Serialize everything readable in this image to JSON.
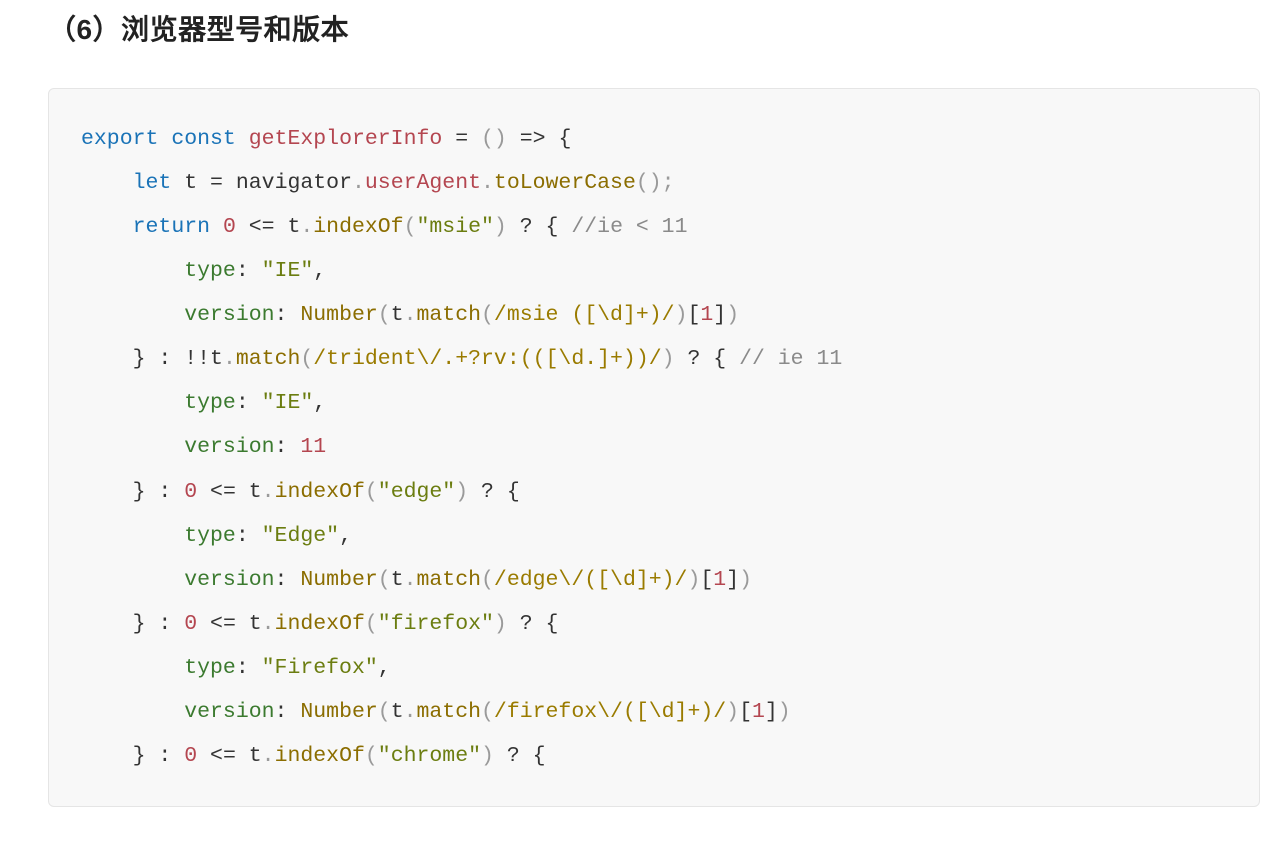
{
  "heading": "（6）浏览器型号和版本",
  "code": {
    "l1": {
      "export": "export",
      "const": "const",
      "fn": "getExplorerInfo",
      "eq": " = ",
      "paren": "()",
      "arrow": " => ",
      "brace": "{"
    },
    "l2": {
      "let": "let",
      "t": "t",
      "eq": " = ",
      "nav": "navigator",
      "dot1": ".",
      "ua": "userAgent",
      "dot2": ".",
      "tlc": "toLowerCase",
      "call": "();"
    },
    "l3": {
      "return": "return",
      "zero": "0",
      "lte": " <= ",
      "t": "t",
      "dot": ".",
      "idx": "indexOf",
      "op": "(",
      "str": "\"msie\"",
      "cp": ")",
      "q": " ? ",
      "br": "{ ",
      "cm": "//ie < 11"
    },
    "l4": {
      "key": "type",
      "colon": ": ",
      "val": "\"IE\"",
      "comma": ","
    },
    "l5": {
      "key": "version",
      "colon": ": ",
      "num": "Number",
      "op": "(",
      "t": "t",
      "dot": ".",
      "match": "match",
      "op2": "(",
      "re": "/msie ([\\d]+)/",
      "cp2": ")",
      "idx": "[",
      "one": "1",
      "idx2": "]",
      "cp": ")"
    },
    "l6": {
      "cb": "}",
      "colon": " : ",
      "bang": "!!",
      "t": "t",
      "dot": ".",
      "match": "match",
      "op": "(",
      "re": "/trident\\/.+?rv:(([\\d.]+))/",
      "cp": ")",
      "q": " ? ",
      "br": "{ ",
      "cm": "// ie 11"
    },
    "l7": {
      "key": "type",
      "colon": ": ",
      "val": "\"IE\"",
      "comma": ","
    },
    "l8": {
      "key": "version",
      "colon": ": ",
      "num": "11"
    },
    "l9": {
      "cb": "}",
      "colon": " : ",
      "zero": "0",
      "lte": " <= ",
      "t": "t",
      "dot": ".",
      "idx": "indexOf",
      "op": "(",
      "str": "\"edge\"",
      "cp": ")",
      "q": " ? ",
      "br": "{"
    },
    "l10": {
      "key": "type",
      "colon": ": ",
      "val": "\"Edge\"",
      "comma": ","
    },
    "l11": {
      "key": "version",
      "colon": ": ",
      "num": "Number",
      "op": "(",
      "t": "t",
      "dot": ".",
      "match": "match",
      "op2": "(",
      "re": "/edge\\/([\\d]+)/",
      "cp2": ")",
      "idx": "[",
      "one": "1",
      "idx2": "]",
      "cp": ")"
    },
    "l12": {
      "cb": "}",
      "colon": " : ",
      "zero": "0",
      "lte": " <= ",
      "t": "t",
      "dot": ".",
      "idx": "indexOf",
      "op": "(",
      "str": "\"firefox\"",
      "cp": ")",
      "q": " ? ",
      "br": "{"
    },
    "l13": {
      "key": "type",
      "colon": ": ",
      "val": "\"Firefox\"",
      "comma": ","
    },
    "l14": {
      "key": "version",
      "colon": ": ",
      "num": "Number",
      "op": "(",
      "t": "t",
      "dot": ".",
      "match": "match",
      "op2": "(",
      "re": "/firefox\\/([\\d]+)/",
      "cp2": ")",
      "idx": "[",
      "one": "1",
      "idx2": "]",
      "cp": ")"
    },
    "l15": {
      "cb": "}",
      "colon": " : ",
      "zero": "0",
      "lte": " <= ",
      "t": "t",
      "dot": ".",
      "idx": "indexOf",
      "op": "(",
      "str": "\"chrome\"",
      "cp": ")",
      "q": " ? ",
      "br": "{"
    }
  }
}
